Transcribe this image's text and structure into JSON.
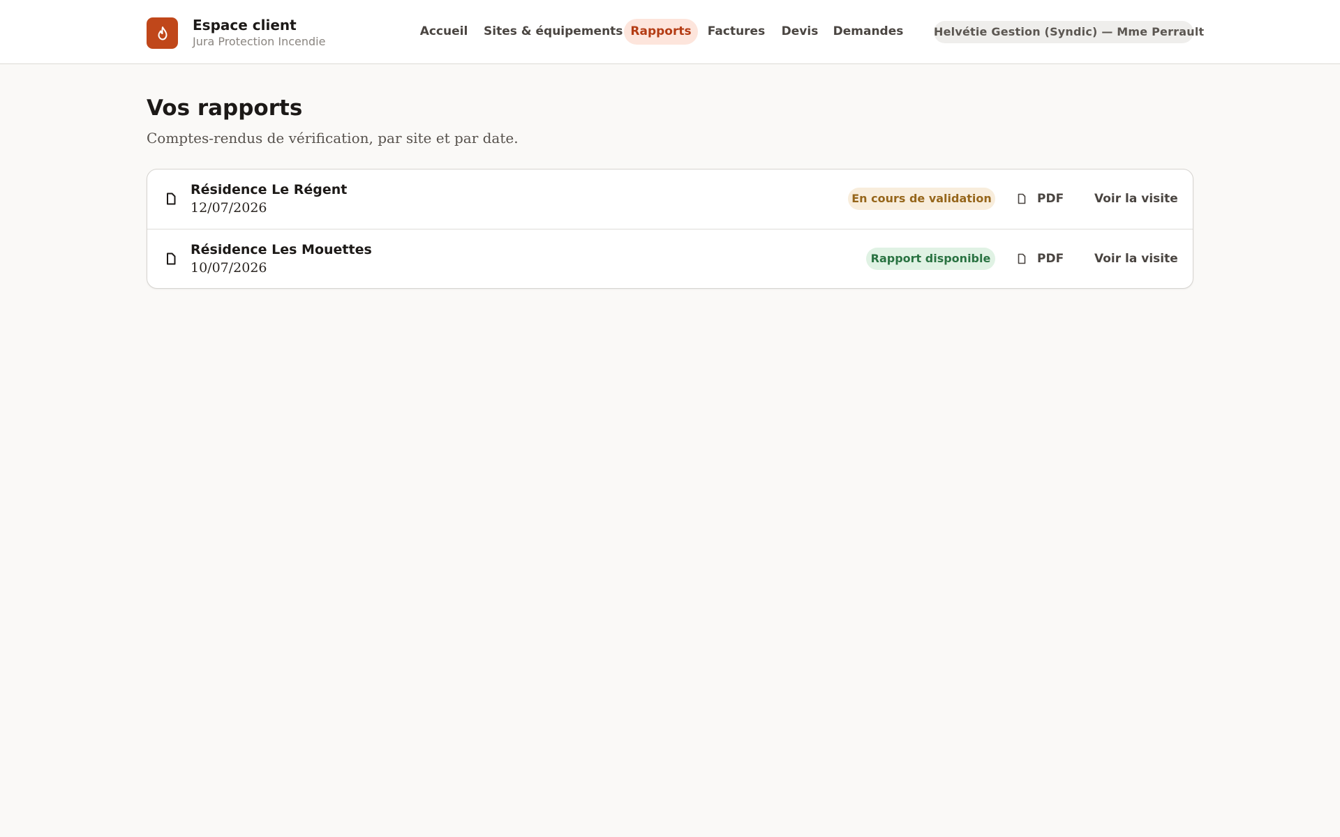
{
  "header": {
    "title": "Espace client",
    "subtitle": "Jura Protection Incendie",
    "logo_icon": "flame-icon",
    "brand_color": "#c0471a",
    "nav": [
      {
        "label": "Accueil",
        "active": false
      },
      {
        "label": "Sites & équipements",
        "active": false
      },
      {
        "label": "Rapports",
        "active": true
      },
      {
        "label": "Factures",
        "active": false
      },
      {
        "label": "Devis",
        "active": false
      },
      {
        "label": "Demandes",
        "active": false
      }
    ],
    "account": "Helvétie Gestion (Syndic) — Mme Perrault"
  },
  "main": {
    "title": "Vos rapports",
    "subtitle": "Comptes-rendus de vérification, par site et par date.",
    "reports": [
      {
        "icon": "document-icon",
        "site": "Résidence Le Régent",
        "date": "12/07/2026",
        "status": "En cours de validation",
        "status_color": "#96661b",
        "pdf_label": "PDF",
        "visit_label": "Voir la visite"
      },
      {
        "icon": "document-icon",
        "site": "Résidence Les Mouettes",
        "date": "10/07/2026",
        "status": "Rapport disponible",
        "status_color": "#2a7342",
        "pdf_label": "PDF",
        "visit_label": "Voir la visite"
      }
    ]
  }
}
